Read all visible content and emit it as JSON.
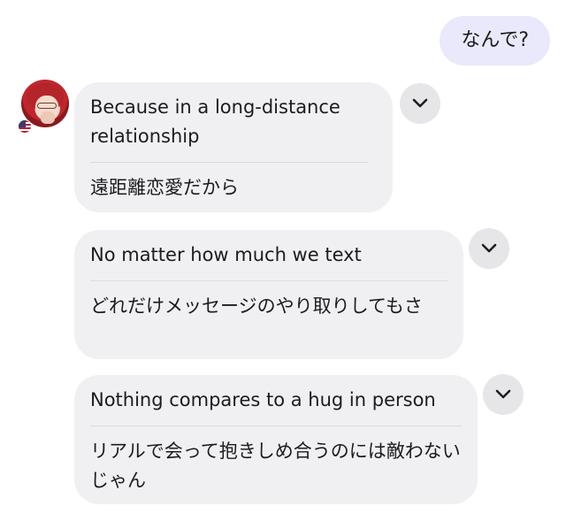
{
  "outgoing": {
    "text": "なんで?"
  },
  "sender": {
    "avatar_icon": "user-avatar-illustration",
    "flag_icon": "us-flag-icon"
  },
  "messages": [
    {
      "english": "Because in a long-distance relationship",
      "japanese": "遠距離恋愛だから",
      "action_icon": "chevron-down-icon"
    },
    {
      "english": "No matter how much we text",
      "japanese": "どれだけメッセージのやり取りしてもさ",
      "action_icon": "chevron-down-icon"
    },
    {
      "english": "Nothing compares to a hug in person",
      "japanese": "リアルで会って抱きしめ合うのには敵わないじゃん",
      "action_icon": "chevron-down-icon"
    }
  ],
  "colors": {
    "outgoing_bubble": "#e9e9fb",
    "incoming_bubble": "#f0f0f2",
    "chevron_button": "#e6e6e8",
    "text": "#1c1c1e"
  }
}
